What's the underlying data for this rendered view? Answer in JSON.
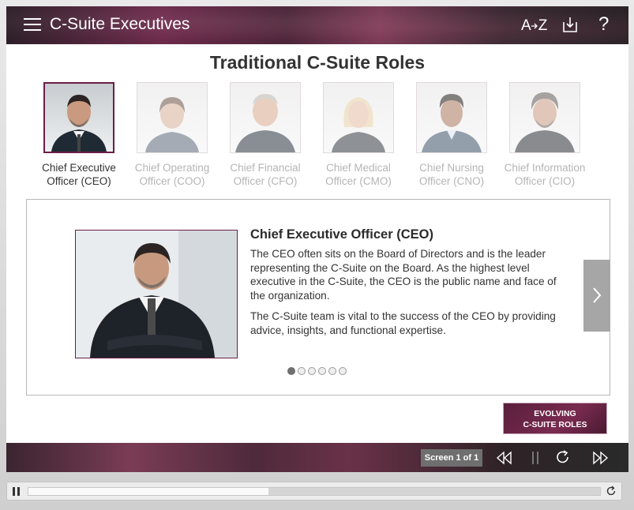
{
  "header": {
    "title": "C-Suite Executives",
    "icons": [
      "menu-icon",
      "az-glossary-icon",
      "download-icon",
      "help-icon"
    ],
    "az_text": "A",
    "az_text2": "Z",
    "help_text": "?"
  },
  "page": {
    "title": "Traditional C-Suite Roles"
  },
  "roles": [
    {
      "line1": "Chief Executive",
      "line2": "Officer (CEO)",
      "active": true
    },
    {
      "line1": "Chief Operating",
      "line2": "Officer (COO)",
      "active": false
    },
    {
      "line1": "Chief Financial",
      "line2": "Officer (CFO)",
      "active": false
    },
    {
      "line1": "Chief Medical",
      "line2": "Officer (CMO)",
      "active": false
    },
    {
      "line1": "Chief Nursing",
      "line2": "Officer (CNO)",
      "active": false
    },
    {
      "line1": "Chief Information",
      "line2": "Officer (CIO)",
      "active": false
    }
  ],
  "card": {
    "title": "Chief Executive Officer (CEO)",
    "paragraph1": "The CEO often sits on the Board of Directors and is the leader representing the C-Suite on the Board. As the highest level executive in the C-Suite, the CEO is the public name and face of the organization.",
    "paragraph2": "The C-Suite team is vital to the success of the CEO by providing advice, insights, and functional expertise.",
    "dots_total": 6,
    "dots_active": 1
  },
  "evolving_button": {
    "line1": "EVOLVING",
    "line2": "C-SUITE ROLES"
  },
  "footer": {
    "screen_label": "Screen 1 of 1"
  },
  "player": {
    "progress": 0.42
  },
  "colors": {
    "accent": "#6a1f45",
    "inactive_text": "#b5b5b5"
  }
}
